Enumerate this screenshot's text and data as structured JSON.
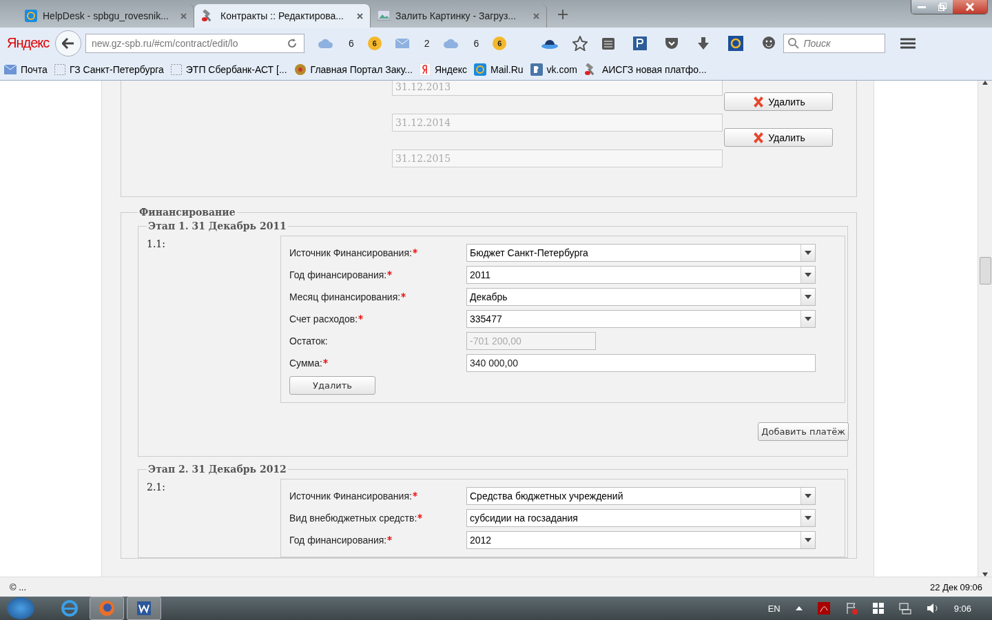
{
  "browser": {
    "tabs": [
      {
        "title": "HelpDesk - spbgu_rovesnik...",
        "selected": false
      },
      {
        "title": "Контракты :: Редактирова...",
        "selected": true
      },
      {
        "title": "Залить Картинку - Загруз...",
        "selected": false
      }
    ],
    "brand": "Яндекс",
    "address": "new.gz-spb.ru/#cm/contract/edit/lo",
    "widgets": [
      {
        "kind": "cloud",
        "count": "6"
      },
      {
        "kind": "coin",
        "count": "6"
      },
      {
        "kind": "mail",
        "count": "2"
      },
      {
        "kind": "cloud",
        "count": "6"
      },
      {
        "kind": "coin",
        "count": "6"
      }
    ],
    "search": {
      "placeholder": "Поиск"
    },
    "bookmarks": [
      {
        "kind": "mail",
        "label": "Почта"
      },
      {
        "kind": "blank",
        "label": "ГЗ Санкт-Петербурга"
      },
      {
        "kind": "blank",
        "label": "ЭТП Сбербанк-АСТ [..."
      },
      {
        "kind": "emblem",
        "label": "Главная Портал Заку..."
      },
      {
        "kind": "yandex",
        "label": "Яндекс"
      },
      {
        "kind": "at",
        "label": "Mail.Ru"
      },
      {
        "kind": "vk",
        "label": "vk.com"
      },
      {
        "kind": "hammer",
        "label": "АИСГЗ новая платфо..."
      }
    ]
  },
  "dates": [
    {
      "value": "31.12.2013",
      "delete_label": "Удалить"
    },
    {
      "value": "31.12.2014",
      "delete_label": "Удалить"
    },
    {
      "value": "31.12.2015"
    }
  ],
  "financing": {
    "legend": "Финансирование",
    "stages": [
      {
        "legend": "Этап 1. 31 Декабрь 2011",
        "payments": [
          {
            "number": "1.1:",
            "fields": [
              {
                "kind": "select",
                "label": "Источник Финансирования:",
                "required": true,
                "value": "Бюджет Санкт-Петербурга"
              },
              {
                "kind": "select",
                "label": "Год финансирования:",
                "required": true,
                "value": "2011"
              },
              {
                "kind": "select",
                "label": "Месяц финансирования:",
                "required": true,
                "value": "Декабрь"
              },
              {
                "kind": "select",
                "label": "Счет расходов:",
                "required": true,
                "value": "335477"
              },
              {
                "kind": "readonly",
                "label": "Остаток:",
                "required": false,
                "value": "-701 200,00"
              },
              {
                "kind": "input",
                "label": "Сумма:",
                "required": true,
                "value": "340 000,00"
              }
            ],
            "delete_label": "Удалить"
          }
        ],
        "add_label": "Добавить платёж"
      },
      {
        "legend": "Этап 2. 31 Декабрь 2012",
        "payments": [
          {
            "number": "2.1:",
            "fields": [
              {
                "kind": "select",
                "label": "Источник Финансирования:",
                "required": true,
                "value": "Средства бюджетных учреждений"
              },
              {
                "kind": "select",
                "label": "Вид внебюджетных средств:",
                "required": true,
                "value": "субсидии на госзадания"
              },
              {
                "kind": "select",
                "label": "Год финансирования:",
                "required": true,
                "value": "2012"
              }
            ]
          }
        ]
      }
    ]
  },
  "status_bar": {
    "left": "© ...",
    "right": "22 Дек 09:06"
  },
  "taskbar": {
    "apps": [
      {
        "kind": "ie",
        "selected": false
      },
      {
        "kind": "firefox",
        "selected": true
      },
      {
        "kind": "word",
        "selected": true
      }
    ],
    "language": "EN",
    "time": "9:06"
  }
}
